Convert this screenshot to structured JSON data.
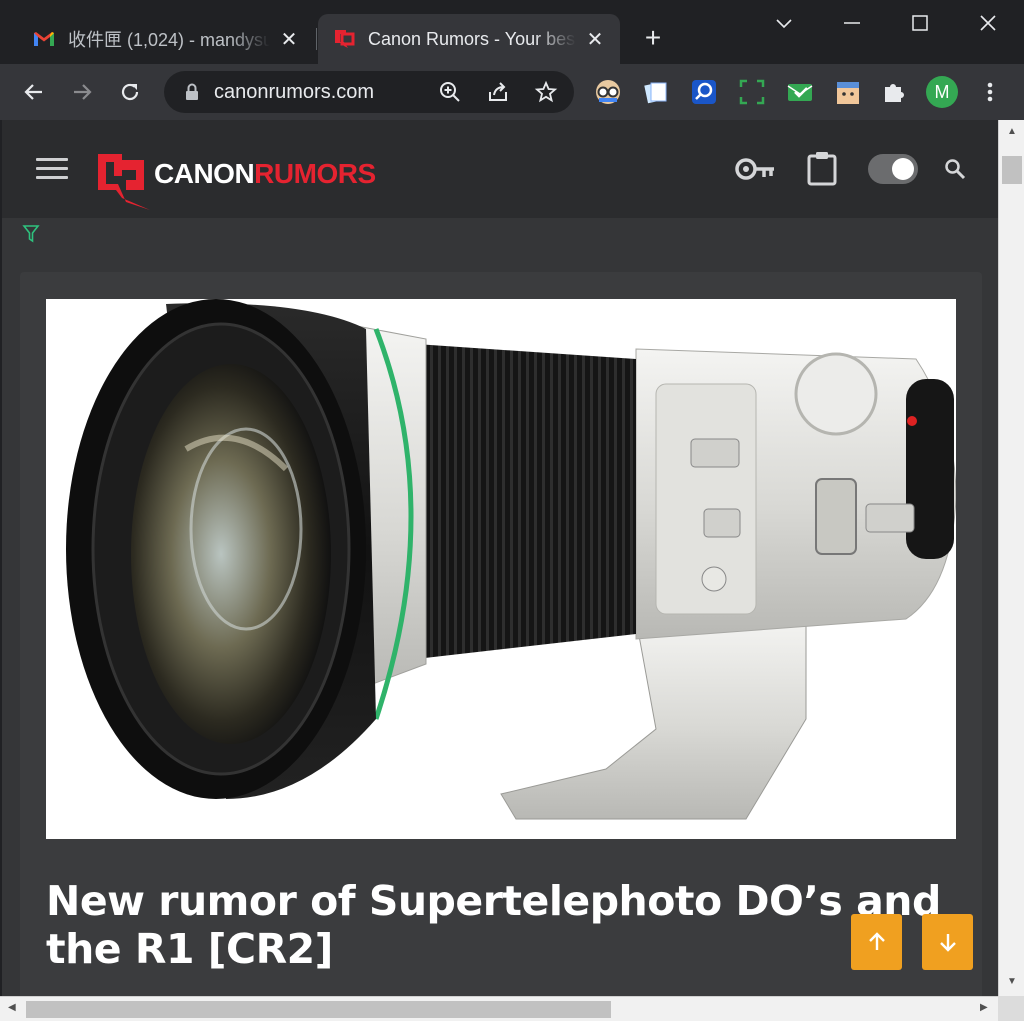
{
  "tabs": [
    {
      "title": "收件匣 (1,024) - mandysu",
      "icon": "gmail-icon",
      "active": false
    },
    {
      "title": "Canon Rumors - Your best",
      "icon": "canon-rumors-icon",
      "active": true
    }
  ],
  "browser": {
    "url": "canonrumors.com",
    "profile_initial": "M",
    "accent_color": "#34a853"
  },
  "site": {
    "logo_part1": "CANON",
    "logo_part2": "RUMORS",
    "brand_color": "#e52330",
    "dark_mode": true
  },
  "article": {
    "headline": "New rumor of Supertelephoto DO’s and the R1 [CR2]",
    "image_subject": "Canon super-telephoto DO lens"
  },
  "fab": {
    "up_icon": "arrow-up-icon",
    "down_icon": "arrow-down-icon",
    "color": "#f0a020"
  }
}
